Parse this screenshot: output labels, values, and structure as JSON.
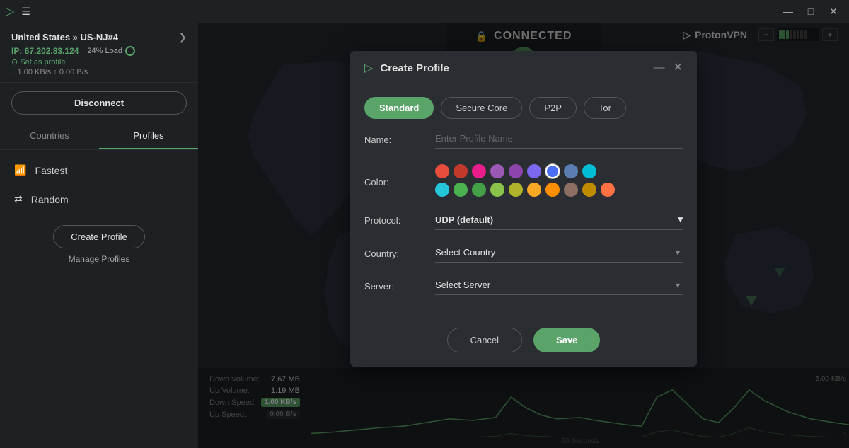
{
  "titlebar": {
    "menu_icon": "☰",
    "logo_icon": "▷",
    "min_label": "—",
    "restore_label": "□",
    "close_label": "✕"
  },
  "sidebar": {
    "server_name": "United States » US-NJ#4",
    "ip_label": "IP: 67.202.83.124",
    "load_label": "24% Load",
    "speed_label": "↓ 1.00 KB/s  ↑ 0.00 B/s",
    "set_profile_label": "⊙ Set as profile",
    "disconnect_label": "Disconnect",
    "tabs": [
      {
        "label": "Countries",
        "active": false
      },
      {
        "label": "Profiles",
        "active": true
      }
    ],
    "menu_items": [
      {
        "icon": "📶",
        "label": "Fastest"
      },
      {
        "icon": "⇄",
        "label": "Random"
      }
    ],
    "create_profile_label": "Create Profile",
    "manage_profiles_label": "Manage Profiles"
  },
  "header": {
    "connected_label": "CONNECTED",
    "lock_icon": "🔒",
    "home_icon": "⌂",
    "proton_icon": "▷",
    "proton_label": "ProtonVPN",
    "speed_label": "5.00 KB/s"
  },
  "dialog": {
    "title": "Create Profile",
    "icon": "▷",
    "profile_tabs": [
      {
        "label": "Standard",
        "active": true
      },
      {
        "label": "Secure Core",
        "active": false
      },
      {
        "label": "P2P",
        "active": false
      },
      {
        "label": "Tor",
        "active": false
      }
    ],
    "fields": {
      "name_label": "Name:",
      "name_placeholder": "Enter Profile Name",
      "color_label": "Color:",
      "protocol_label": "Protocol:",
      "protocol_value": "UDP (default)",
      "country_label": "Country:",
      "country_placeholder": "Select Country",
      "server_label": "Server:",
      "server_placeholder": "Select Server"
    },
    "colors_row1": [
      {
        "hex": "#e74c3c",
        "selected": false
      },
      {
        "hex": "#c0392b",
        "selected": false
      },
      {
        "hex": "#e91e8c",
        "selected": false
      },
      {
        "hex": "#9b59b6",
        "selected": false
      },
      {
        "hex": "#8e44ad",
        "selected": false
      },
      {
        "hex": "#7b68ee",
        "selected": false
      },
      {
        "hex": "#4a6ef5",
        "selected": true
      },
      {
        "hex": "#5b7db1",
        "selected": false
      },
      {
        "hex": "#00bcd4",
        "selected": false
      }
    ],
    "colors_row2": [
      {
        "hex": "#26c6da",
        "selected": false
      },
      {
        "hex": "#4caf50",
        "selected": false
      },
      {
        "hex": "#43a047",
        "selected": false
      },
      {
        "hex": "#8bc34a",
        "selected": false
      },
      {
        "hex": "#afb42b",
        "selected": false
      },
      {
        "hex": "#f9a825",
        "selected": false
      },
      {
        "hex": "#ff8f00",
        "selected": false
      },
      {
        "hex": "#8d6e63",
        "selected": false
      },
      {
        "hex": "#bf8c00",
        "selected": false
      },
      {
        "hex": "#ff7043",
        "selected": false
      }
    ],
    "cancel_label": "Cancel",
    "save_label": "Save"
  },
  "stats": {
    "down_volume_label": "Down Volume:",
    "down_volume_value": "7.67",
    "down_volume_unit": "MB",
    "up_volume_label": "Up Volume:",
    "up_volume_value": "1.19",
    "up_volume_unit": "MB",
    "down_speed_label": "Down Speed:",
    "down_speed_value": "1.00",
    "down_speed_unit": "KB/s",
    "up_speed_label": "Up Speed:",
    "up_speed_value": "0.00",
    "up_speed_unit": "B/s",
    "chart_label": "60 Seconds",
    "speed_label": "5.00 KB/s",
    "time_label": "0"
  }
}
